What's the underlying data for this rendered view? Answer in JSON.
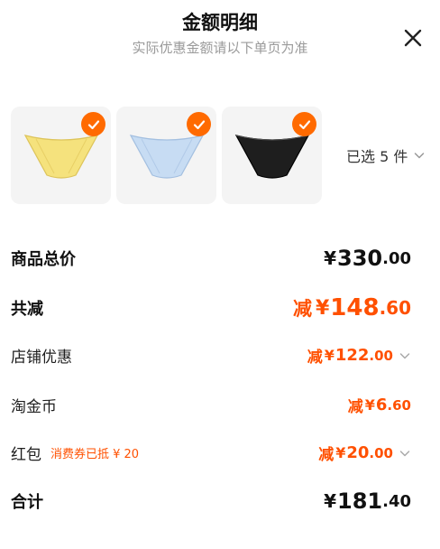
{
  "header": {
    "title": "金额明细",
    "subtitle": "实际优惠金额请以下单页为准"
  },
  "products": [
    {
      "color": "#f5e27d",
      "accent": "#e8d060"
    },
    {
      "color": "#c7dcf3",
      "accent": "#a9c5e6"
    },
    {
      "color": "#1e1e1e",
      "accent": "#111111"
    }
  ],
  "selection": {
    "label": "已选 5 件"
  },
  "rows": {
    "goods_total": {
      "label": "商品总价",
      "yen": "¥",
      "int": "330",
      "dec": ".00"
    },
    "total_discount": {
      "label": "共减",
      "prefix": "减",
      "yen": "¥",
      "int": "148",
      "dec": ".60"
    },
    "shop_discount": {
      "label": "店铺优惠",
      "prefix": "减",
      "yen": "¥",
      "int": "122",
      "dec": ".00"
    },
    "taojinbi": {
      "label": "淘金币",
      "prefix": "减",
      "yen": "¥",
      "int": "6",
      "dec": ".60"
    },
    "red_packet": {
      "label": "红包",
      "note": "消费券已抵 ¥ 20",
      "prefix": "减",
      "yen": "¥",
      "int": "20",
      "dec": ".00"
    },
    "sum": {
      "label": "合计",
      "yen": "¥",
      "int": "181",
      "dec": ".40"
    }
  },
  "colors": {
    "accent": "#ff5000",
    "check": "#ff6a00",
    "thumb_bg": "#f4f4f4"
  },
  "icons": {
    "close": "close-icon",
    "check": "check-icon",
    "chevron": "chevron-down-icon"
  }
}
